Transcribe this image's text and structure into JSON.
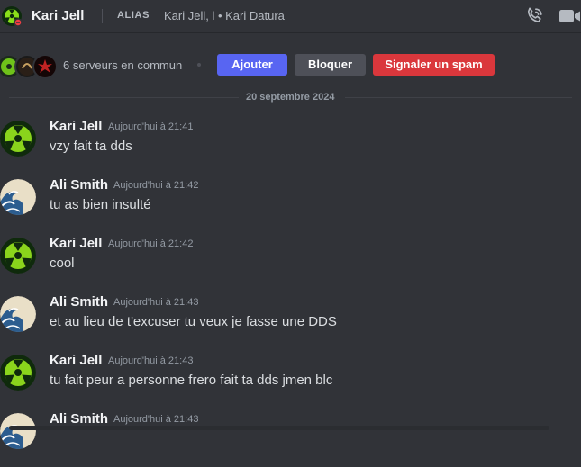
{
  "header": {
    "username": "Kari Jell",
    "alias_label": "ALIAS",
    "alias_value": "Kari Jell, l • Kari Datura",
    "icons": [
      "avatar-radioactive",
      "call-icon",
      "video-icon"
    ]
  },
  "profile_bar": {
    "mutual_servers": "6 serveurs en commun",
    "buttons": {
      "add": "Ajouter",
      "block": "Bloquer",
      "report_spam": "Signaler un spam"
    }
  },
  "divider": {
    "date": "20 septembre 2024"
  },
  "messages": [
    {
      "author": "Kari Jell",
      "time": "Aujourd'hui à 21:41",
      "text": "vzy fait ta dds",
      "avatar": "radioactive"
    },
    {
      "author": "Ali Smith",
      "time": "Aujourd'hui à 21:42",
      "text": "tu as bien insulté",
      "avatar": "wave"
    },
    {
      "author": "Kari Jell",
      "time": "Aujourd'hui à 21:42",
      "text": "cool",
      "avatar": "radioactive"
    },
    {
      "author": "Ali Smith",
      "time": "Aujourd'hui à 21:43",
      "text": "et au lieu de t'excuser tu veux je fasse une DDS",
      "avatar": "wave"
    },
    {
      "author": "Kari Jell",
      "time": "Aujourd'hui à 21:43",
      "text": "tu fait peur a personne frero fait ta dds jmen blc",
      "avatar": "radioactive"
    },
    {
      "author": "Ali Smith",
      "time": "Aujourd'hui à 21:43",
      "text": "",
      "avatar": "wave"
    }
  ],
  "colors": {
    "background": "#313338",
    "add_button": "#5865f2",
    "block_button": "#4e5058",
    "spam_button": "#da373c",
    "status_dnd": "#f23f43"
  }
}
